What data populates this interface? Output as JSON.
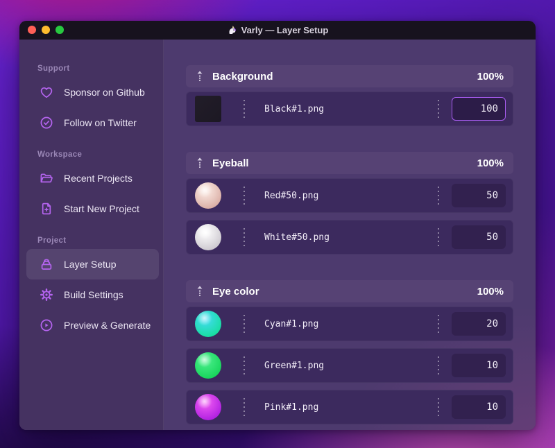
{
  "window": {
    "title": "Varly — Layer Setup",
    "controls": [
      "close",
      "minimize",
      "zoom"
    ]
  },
  "sidebar": {
    "sections": [
      {
        "label": "Support",
        "items": [
          {
            "label": "Sponsor on Github",
            "icon": "heart"
          },
          {
            "label": "Follow on Twitter",
            "icon": "check-badge"
          }
        ]
      },
      {
        "label": "Workspace",
        "items": [
          {
            "label": "Recent Projects",
            "icon": "folder"
          },
          {
            "label": "Start New Project",
            "icon": "file-plus"
          }
        ]
      },
      {
        "label": "Project",
        "items": [
          {
            "label": "Layer Setup",
            "icon": "layers-box",
            "active": true
          },
          {
            "label": "Build Settings",
            "icon": "gear"
          },
          {
            "label": "Preview & Generate",
            "icon": "play-circle"
          }
        ]
      }
    ]
  },
  "layers": {
    "groups": [
      {
        "name": "Background",
        "weight": "100%",
        "items": [
          {
            "file": "Black#1.png",
            "value": "100",
            "thumb": {
              "type": "square",
              "colors": [
                "#221d29",
                "#1c1823"
              ]
            },
            "focused": true
          }
        ]
      },
      {
        "name": "Eyeball",
        "weight": "100%",
        "items": [
          {
            "file": "Red#50.png",
            "value": "50",
            "thumb": {
              "type": "sphere",
              "colors": [
                "#fdeee7",
                "#d5a49b"
              ]
            }
          },
          {
            "file": "White#50.png",
            "value": "50",
            "thumb": {
              "type": "sphere",
              "colors": [
                "#ffffff",
                "#c6c1c9"
              ]
            }
          }
        ]
      },
      {
        "name": "Eye color",
        "weight": "100%",
        "items": [
          {
            "file": "Cyan#1.png",
            "value": "20",
            "thumb": {
              "type": "sphere",
              "colors": [
                "#45dcf5",
                "#10dd92"
              ]
            }
          },
          {
            "file": "Green#1.png",
            "value": "10",
            "thumb": {
              "type": "sphere",
              "colors": [
                "#4df08e",
                "#0fd153"
              ]
            }
          },
          {
            "file": "Pink#1.png",
            "value": "10",
            "thumb": {
              "type": "sphere",
              "colors": [
                "#f45ef5",
                "#a517dd"
              ]
            }
          }
        ]
      }
    ]
  },
  "colors": {
    "accent": "#a85cf0",
    "sidebar_icon": "#b564f0",
    "traffic_close": "#ff5f57",
    "traffic_minimize": "#febc2e",
    "traffic_zoom": "#28c840"
  }
}
